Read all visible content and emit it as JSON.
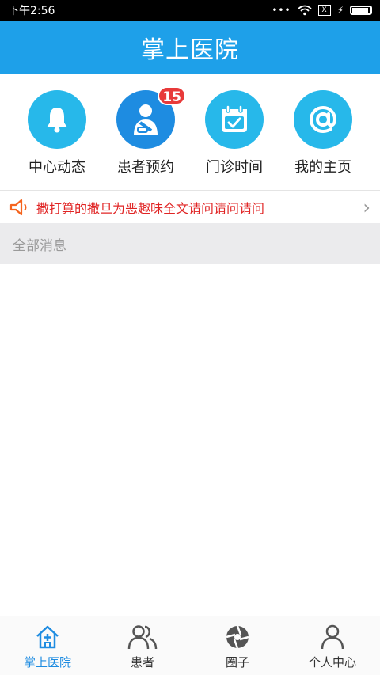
{
  "status_bar": {
    "time": "下午2:56",
    "sim_label": "X"
  },
  "header": {
    "title": "掌上医院"
  },
  "quick_actions": [
    {
      "label": "中心动态",
      "icon": "bell-icon",
      "badge": ""
    },
    {
      "label": "患者预约",
      "icon": "patient-icon",
      "badge": "15"
    },
    {
      "label": "门诊时间",
      "icon": "calendar-check-icon",
      "badge": ""
    },
    {
      "label": "我的主页",
      "icon": "at-icon",
      "badge": ""
    }
  ],
  "notice": {
    "text": "撒打算的撒旦为恶趣味全文请问请问请问",
    "icon": "speaker-icon"
  },
  "messages": {
    "section_title": "全部消息"
  },
  "tabs": [
    {
      "label": "掌上医院",
      "icon": "home-cross-icon",
      "active": true
    },
    {
      "label": "患者",
      "icon": "users-icon",
      "active": false
    },
    {
      "label": "圈子",
      "icon": "aperture-icon",
      "active": false
    },
    {
      "label": "个人中心",
      "icon": "user-icon",
      "active": false
    }
  ],
  "colors": {
    "primary": "#1EA0E9",
    "icon_circle": "#27B8EA",
    "active_tab": "#1E8CE1",
    "badge": "#E83A3A",
    "notice_text": "#E02424"
  },
  "battery_level": 0.9
}
